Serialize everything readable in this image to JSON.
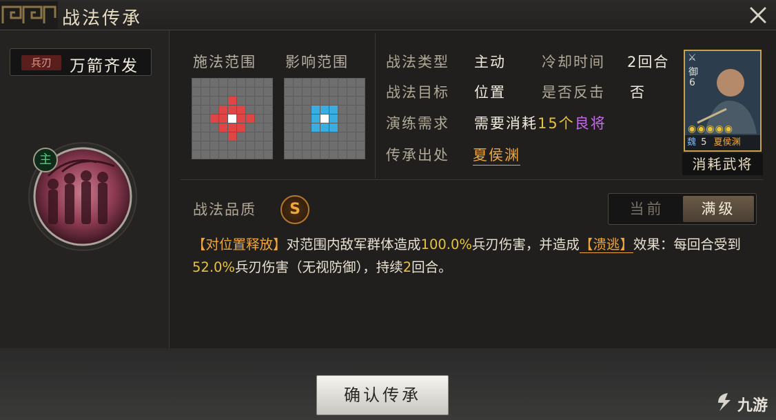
{
  "window": {
    "title": "战法传承"
  },
  "skill": {
    "type_tag": "兵刃",
    "name": "万箭齐发",
    "main_badge": "主"
  },
  "range": {
    "cast_label": "施法范围",
    "effect_label": "影响范围",
    "cast_color": "#e04545",
    "effect_color": "#3aaee0"
  },
  "info": {
    "type_label": "战法类型",
    "type_value": "主动",
    "cooldown_label": "冷却时间",
    "cooldown_value": "2回合",
    "target_label": "战法目标",
    "target_value": "位置",
    "counter_label": "是否反击",
    "counter_value": "否",
    "practice_label": "演练需求",
    "practice_prefix": "需要消耗",
    "practice_count": "15个",
    "practice_item": "良将",
    "source_label": "传承出处",
    "source_value": "夏侯渊"
  },
  "general_card": {
    "troop_type": "御",
    "cost": "6",
    "stars": 5,
    "faction": "魏",
    "level": "5",
    "name": "夏侯渊",
    "consume_label": "消耗武将"
  },
  "quality": {
    "label": "战法品质",
    "grade": "S"
  },
  "toggle": {
    "current": "当前",
    "max": "满级"
  },
  "description": {
    "tag1": "【对位置释放】",
    "t1": "对范围内敌军群体造成",
    "num1": "100.0%",
    "t2": "兵刃伤害，并造成",
    "tag2": "【溃逃】",
    "t3": "效果：每回合受到",
    "num2": "52.0%",
    "t4": "兵刃伤害（无视防御），持续",
    "num3": "2",
    "t5": "回合。"
  },
  "footer": {
    "confirm_label": "确认传承"
  },
  "watermark": {
    "text": "九游"
  }
}
